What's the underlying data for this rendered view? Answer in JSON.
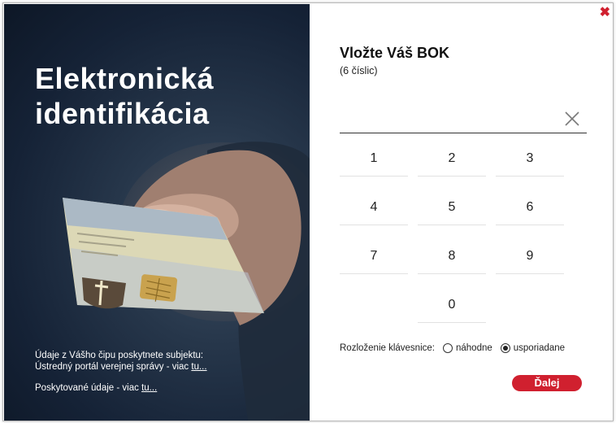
{
  "hero": {
    "title_line1": "Elektronická",
    "title_line2": "identifikácia",
    "footer_line1": "Údaje z Vášho čipu poskytnete subjektu:",
    "footer_line2": "Ústredný portál verejnej správy - viac",
    "footer_link1": "tu...",
    "footer_line3": "Poskytované údaje - viac",
    "footer_link2": "tu..."
  },
  "dialog": {
    "title": "Vložte Váš BOK",
    "subtitle": "(6 číslic)",
    "pin_value": "",
    "keys": [
      "1",
      "2",
      "3",
      "4",
      "5",
      "6",
      "7",
      "8",
      "9",
      "0"
    ],
    "layout_label": "Rozloženie klávesnice:",
    "option_random": "náhodne",
    "option_ordered": "usporiadane",
    "selected_option": "usporiadane",
    "next_label": "Ďalej"
  },
  "icons": {
    "close": "close-icon",
    "clear": "clear-input-icon"
  },
  "colors": {
    "accent": "#d0202f",
    "hero_bg": "#1b2a3e"
  }
}
